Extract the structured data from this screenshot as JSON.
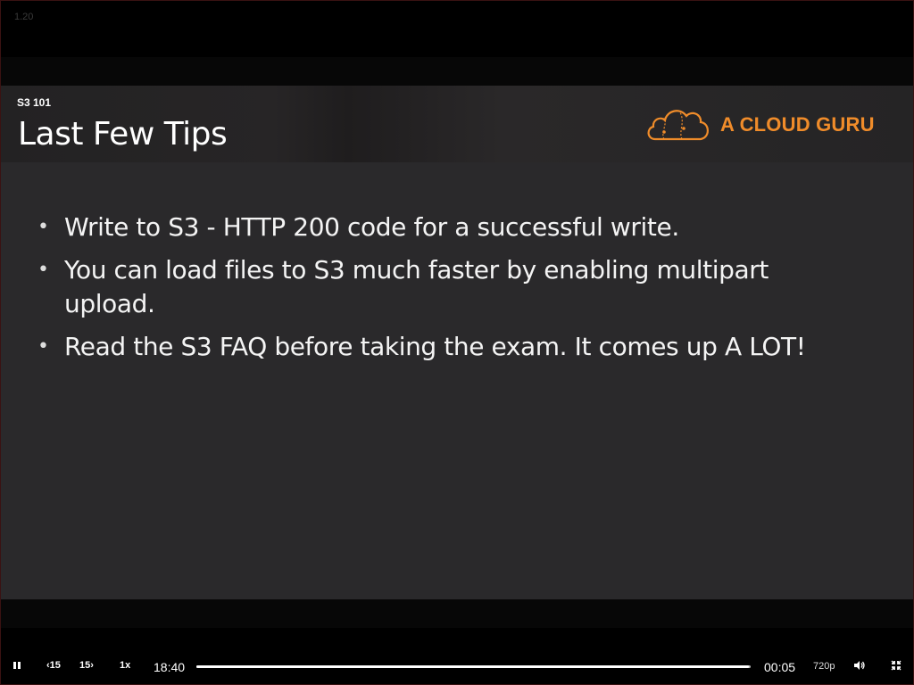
{
  "version": "1.20",
  "slide": {
    "course_code": "S3 101",
    "title": "Last Few Tips",
    "logo_text": "A CLOUD GURU",
    "bullets": [
      {
        "lines": [
          "Write to S3 - HTTP 200 code for a successful write."
        ]
      },
      {
        "lines": [
          "You can load files to S3 much faster by enabling multipart",
          "upload."
        ]
      },
      {
        "lines": [
          "Read the S3 FAQ before taking the exam. It comes up A LOT!"
        ]
      }
    ]
  },
  "controls": {
    "rewind_label": "15",
    "forward_label": "15",
    "speed_label": "1x",
    "elapsed": "18:40",
    "remaining": "00:05",
    "quality": "720p",
    "progress": 0.996
  },
  "colors": {
    "accent": "#f08c2a",
    "slide_bg": "#2a292b"
  },
  "icons": [
    "pause-icon",
    "rewind-15-icon",
    "forward-15-icon",
    "volume-icon",
    "exit-fullscreen-icon",
    "cloud-logo-icon"
  ]
}
